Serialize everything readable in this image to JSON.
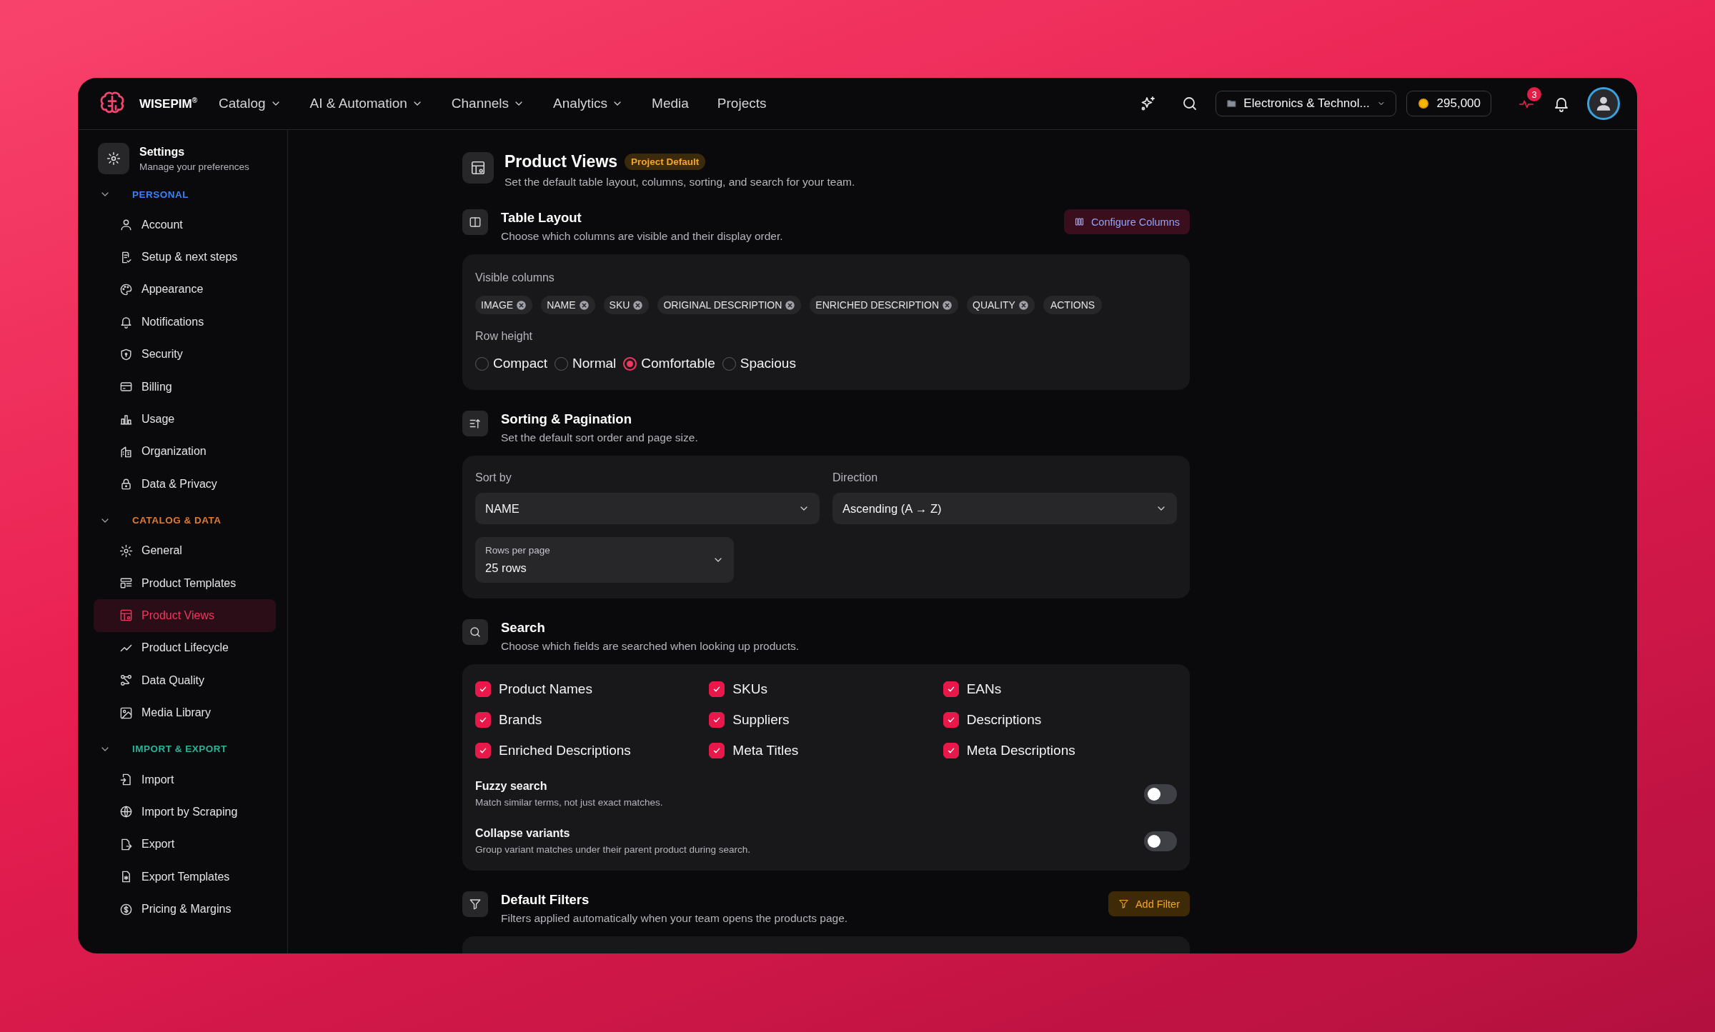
{
  "nav": {
    "brand": "WISEPIM$^{®}$",
    "menus": [
      {
        "label": "Catalog",
        "dropdown": true
      },
      {
        "label": "AI & Automation",
        "dropdown": true
      },
      {
        "label": "Channels",
        "dropdown": true
      },
      {
        "label": "Analytics",
        "dropdown": true
      },
      {
        "label": "Media",
        "dropdown": false
      },
      {
        "label": "Projects",
        "dropdown": false
      }
    ],
    "workspace": "Electronics & Technol...",
    "credits": "295,000",
    "activity_count": "3"
  },
  "sidebar": {
    "title": "Settings",
    "subtitle": "Manage your preferences",
    "groups": [
      {
        "label": "PERSONAL",
        "color": "#3b82f6",
        "expanded": true,
        "items": [
          {
            "label": "Account",
            "selected": false
          },
          {
            "label": "Setup & next steps",
            "selected": false
          },
          {
            "label": "Appearance",
            "selected": false
          },
          {
            "label": "Notifications",
            "selected": false
          },
          {
            "label": "Security",
            "selected": false
          },
          {
            "label": "Billing",
            "selected": false
          },
          {
            "label": "Usage",
            "selected": false
          },
          {
            "label": "Organization",
            "selected": false
          },
          {
            "label": "Data & Privacy",
            "selected": false
          }
        ]
      },
      {
        "label": "CATALOG & DATA",
        "color": "#e07b2e",
        "expanded": true,
        "items": [
          {
            "label": "General",
            "selected": false
          },
          {
            "label": "Product Templates",
            "selected": false
          },
          {
            "label": "Product Views",
            "selected": true
          },
          {
            "label": "Product Lifecycle",
            "selected": false
          },
          {
            "label": "Data Quality",
            "selected": false
          },
          {
            "label": "Media Library",
            "selected": false
          }
        ]
      },
      {
        "label": "IMPORT & EXPORT",
        "color": "#2bb39a",
        "expanded": true,
        "items": [
          {
            "label": "Import",
            "selected": false
          },
          {
            "label": "Import by Scraping",
            "selected": false
          },
          {
            "label": "Export",
            "selected": false
          },
          {
            "label": "Export Templates",
            "selected": false
          },
          {
            "label": "Pricing & Margins",
            "selected": false
          }
        ]
      }
    ]
  },
  "page": {
    "title": "Product Views",
    "badge": "Project Default",
    "description": "Set the default table layout, columns, sorting, and search for your team."
  },
  "sections": [
    {
      "kind": "table_layout",
      "title": "Table Layout",
      "description": "Choose which columns are visible and their display order.",
      "action": "Configure Columns",
      "columns_label": "Visible columns",
      "columns": [
        {
          "label": "IMAGE",
          "removable": true
        },
        {
          "label": "NAME",
          "removable": true
        },
        {
          "label": "SKU",
          "removable": true
        },
        {
          "label": "ORIGINAL DESCRIPTION",
          "removable": true
        },
        {
          "label": "ENRICHED DESCRIPTION",
          "removable": true
        },
        {
          "label": "QUALITY",
          "removable": true
        },
        {
          "label": "ACTIONS",
          "removable": false
        }
      ],
      "row_height_label": "Row height",
      "row_heights": [
        {
          "label": "Compact",
          "selected": false
        },
        {
          "label": "Normal",
          "selected": false
        },
        {
          "label": "Comfortable",
          "selected": true
        },
        {
          "label": "Spacious",
          "selected": false
        }
      ]
    },
    {
      "kind": "sorting",
      "title": "Sorting & Pagination",
      "description": "Set the default sort order and page size.",
      "sort_by": {
        "label": "Sort by",
        "value": "NAME"
      },
      "direction": {
        "label": "Direction",
        "value": "Ascending (A → Z)"
      },
      "rows_per_page": {
        "label": "Rows per page",
        "value": "25 rows"
      }
    },
    {
      "kind": "search",
      "title": "Search",
      "description": "Choose which fields are searched when looking up products.",
      "fields": [
        {
          "label": "Product Names",
          "checked": true
        },
        {
          "label": "SKUs",
          "checked": true
        },
        {
          "label": "EANs",
          "checked": true
        },
        {
          "label": "Brands",
          "checked": true
        },
        {
          "label": "Suppliers",
          "checked": true
        },
        {
          "label": "Descriptions",
          "checked": true
        },
        {
          "label": "Enriched Descriptions",
          "checked": true
        },
        {
          "label": "Meta Titles",
          "checked": true
        },
        {
          "label": "Meta Descriptions",
          "checked": true
        }
      ],
      "toggles": [
        {
          "title": "Fuzzy search",
          "description": "Match similar terms, not just exact matches.",
          "on": false
        },
        {
          "title": "Collapse variants",
          "description": "Group variant matches under their parent product during search.",
          "on": false
        }
      ]
    },
    {
      "kind": "filters",
      "title": "Default Filters",
      "description": "Filters applied automatically when your team opens the products page.",
      "action": "Add Filter"
    }
  ]
}
